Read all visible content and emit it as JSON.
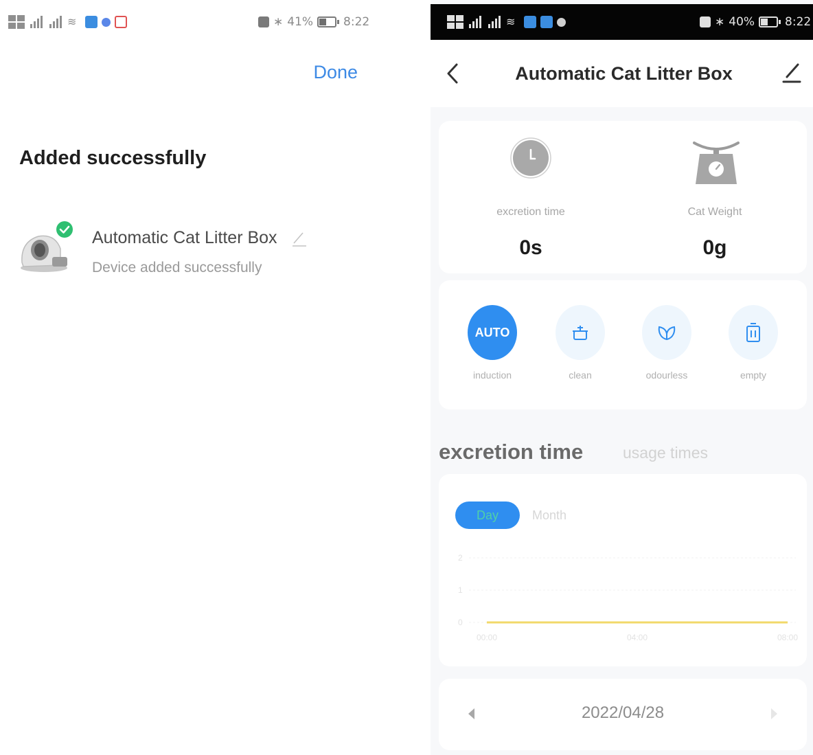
{
  "left_screen": {
    "status_bar": {
      "battery": "41%",
      "time": "8:22"
    },
    "done_label": "Done",
    "title": "Added successfully",
    "device": {
      "name": "Automatic Cat Litter Box",
      "status": "Device added successfully"
    }
  },
  "right_screen": {
    "status_bar": {
      "battery": "40%",
      "time": "8:22"
    },
    "header": {
      "title": "Automatic Cat Litter Box"
    },
    "stats": {
      "excretion_label": "excretion time",
      "excretion_value": "0s",
      "weight_label": "Cat Weight",
      "weight_value": "0g"
    },
    "modes": [
      {
        "label": "induction",
        "badge": "AUTO",
        "active": true,
        "icon": "auto-icon"
      },
      {
        "label": "clean",
        "active": false,
        "icon": "clean-icon"
      },
      {
        "label": "odourless",
        "active": false,
        "icon": "leaf-icon"
      },
      {
        "label": "empty",
        "active": false,
        "icon": "bin-icon"
      }
    ],
    "section_tabs": {
      "active": "excretion time",
      "inactive": "usage times"
    },
    "period": {
      "day": "Day",
      "month": "Month"
    },
    "chart_data": {
      "type": "line",
      "x": [
        "00:00",
        "04:00",
        "08:00"
      ],
      "series": [
        {
          "values": [
            0,
            0,
            0
          ],
          "color": "#f2d96a"
        }
      ],
      "y_ticks": [
        "0",
        "1",
        "2"
      ],
      "ylim": [
        0,
        2
      ],
      "grid": true
    },
    "date": "2022/04/28"
  },
  "colors": {
    "accent": "#2f8ef0",
    "success": "#2fbf71",
    "link": "#3d8ae5"
  }
}
